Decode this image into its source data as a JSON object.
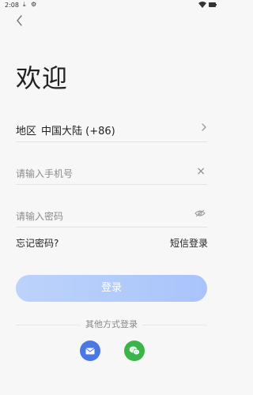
{
  "status": {
    "time": "2:08"
  },
  "header": {
    "title": "欢迎"
  },
  "region": {
    "label": "地区",
    "value": "中国大陆 (+86)"
  },
  "phone": {
    "placeholder": "请输入手机号"
  },
  "password": {
    "placeholder": "请输入密码"
  },
  "links": {
    "forgot": "忘记密码?",
    "sms": "短信登录"
  },
  "actions": {
    "login": "登录"
  },
  "other": {
    "title": "其他方式登录"
  },
  "icons": {
    "back": "chevron-left-icon",
    "download": "download-icon",
    "settings": "settings-icon",
    "wifi": "wifi-icon",
    "battery": "battery-icon",
    "chevron": "chevron-right-icon",
    "clear": "close-icon",
    "eye": "eye-off-icon",
    "mail": "mail-icon",
    "wechat": "wechat-icon"
  },
  "colors": {
    "accent": "#a9c4fb",
    "mail": "#4a77e6",
    "wechat": "#3bb44a"
  }
}
